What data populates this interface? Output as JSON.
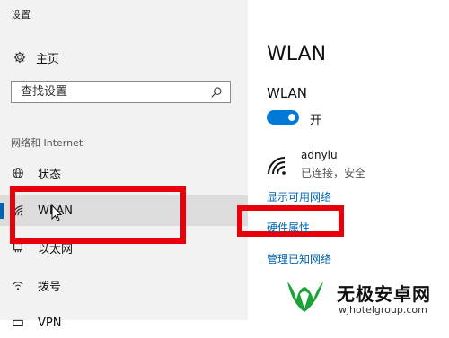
{
  "app": {
    "title": "设置"
  },
  "sidebar": {
    "home_label": "主页",
    "search_placeholder": "查找设置",
    "section_label": "网络和 Internet",
    "items": [
      {
        "label": "状态",
        "icon": "globe-icon"
      },
      {
        "label": "WLAN",
        "icon": "wifi-icon",
        "selected": true
      },
      {
        "label": "以太网",
        "icon": "ethernet-icon"
      },
      {
        "label": "拨号",
        "icon": "dialup-icon"
      },
      {
        "label": "VPN",
        "icon": "vpn-icon"
      }
    ]
  },
  "main": {
    "title": "WLAN",
    "wlan_heading": "WLAN",
    "toggle_label": "开",
    "toggle_on": true,
    "network": {
      "name": "adnylu",
      "status": "已连接，安全"
    },
    "links": [
      "显示可用网络",
      "硬件属性",
      "管理已知网络"
    ]
  },
  "watermark": {
    "name": "无极安卓网",
    "url": "wjhotelgroup.com"
  },
  "colors": {
    "accent": "#0078d7",
    "link": "#0063b1",
    "highlight": "#e8000b",
    "watermark_green": "#1aa336"
  }
}
